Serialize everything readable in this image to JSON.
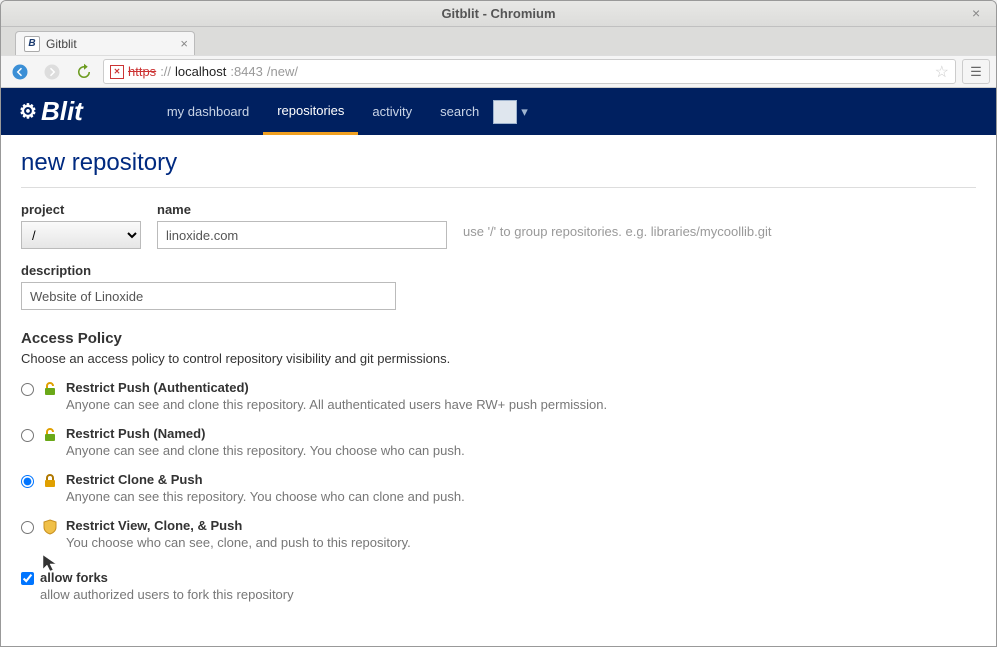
{
  "window": {
    "title": "Gitblit - Chromium"
  },
  "tab": {
    "label": "Gitblit"
  },
  "omnibox": {
    "protocol": "https",
    "host": "localhost",
    "port": ":8443",
    "path": "/new/"
  },
  "nav": {
    "dashboard": "my dashboard",
    "repositories": "repositories",
    "activity": "activity",
    "search": "search"
  },
  "logo_text": "Blit",
  "page_title": "new repository",
  "fields": {
    "project_label": "project",
    "project_value": "/",
    "name_label": "name",
    "name_value": "linoxide.com",
    "name_hint": "use '/' to group repositories. e.g. libraries/mycoollib.git",
    "description_label": "description",
    "description_value": "Website of Linoxide"
  },
  "access_policy": {
    "title": "Access Policy",
    "subtitle": "Choose an access policy to control repository visibility and git permissions.",
    "options": [
      {
        "label": "Restrict Push (Authenticated)",
        "desc": "Anyone can see and clone this repository. All authenticated users have RW+ push permission."
      },
      {
        "label": "Restrict Push (Named)",
        "desc": "Anyone can see and clone this repository. You choose who can push."
      },
      {
        "label": "Restrict Clone & Push",
        "desc": "Anyone can see this repository. You choose who can clone and push."
      },
      {
        "label": "Restrict View, Clone, & Push",
        "desc": "You choose who can see, clone, and push to this repository."
      }
    ],
    "selected_index": 2
  },
  "allow_forks": {
    "label": "allow forks",
    "desc": "allow authorized users to fork this repository",
    "checked": true
  }
}
